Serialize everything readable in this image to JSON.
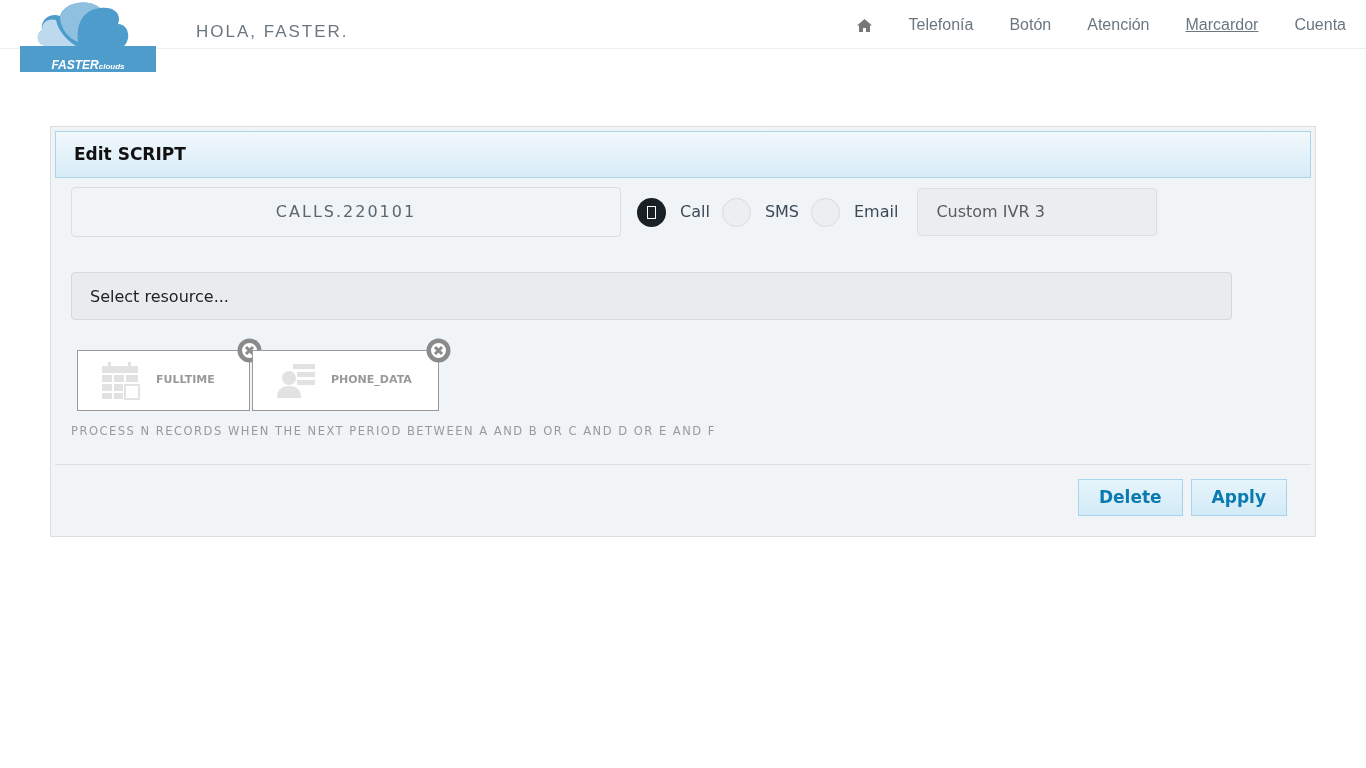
{
  "header": {
    "logo": {
      "text_bold": "FASTER",
      "text_small": "clouds"
    },
    "greeting": "HOLA, FASTER.",
    "nav": [
      {
        "kind": "home",
        "selected": false
      },
      {
        "kind": "link",
        "label": "Telefonía",
        "selected": false
      },
      {
        "kind": "link",
        "label": "Botón",
        "selected": false
      },
      {
        "kind": "link",
        "label": "Atención",
        "selected": false
      },
      {
        "kind": "link",
        "label": "Marcardor",
        "selected": true
      },
      {
        "kind": "link",
        "label": "Cuenta",
        "selected": false
      }
    ]
  },
  "panel": {
    "title": "Edit SCRIPT",
    "script_name": "CALLS.220101",
    "channels": [
      {
        "label": "Call",
        "selected": true
      },
      {
        "label": "SMS",
        "selected": false
      },
      {
        "label": "Email",
        "selected": false
      }
    ],
    "ivr": "Custom IVR 3",
    "resource": {
      "placeholder": "Select resource..."
    },
    "resources": [
      {
        "kind": "calendar",
        "label": "FULLTIME"
      },
      {
        "kind": "contact",
        "label": "PHONE_DATA"
      }
    ],
    "description": "PROCESS N RECORDS WHEN THE NEXT PERIOD BETWEEN A AND B OR C AND D OR E AND F",
    "buttons": [
      "Delete",
      "Apply"
    ]
  }
}
